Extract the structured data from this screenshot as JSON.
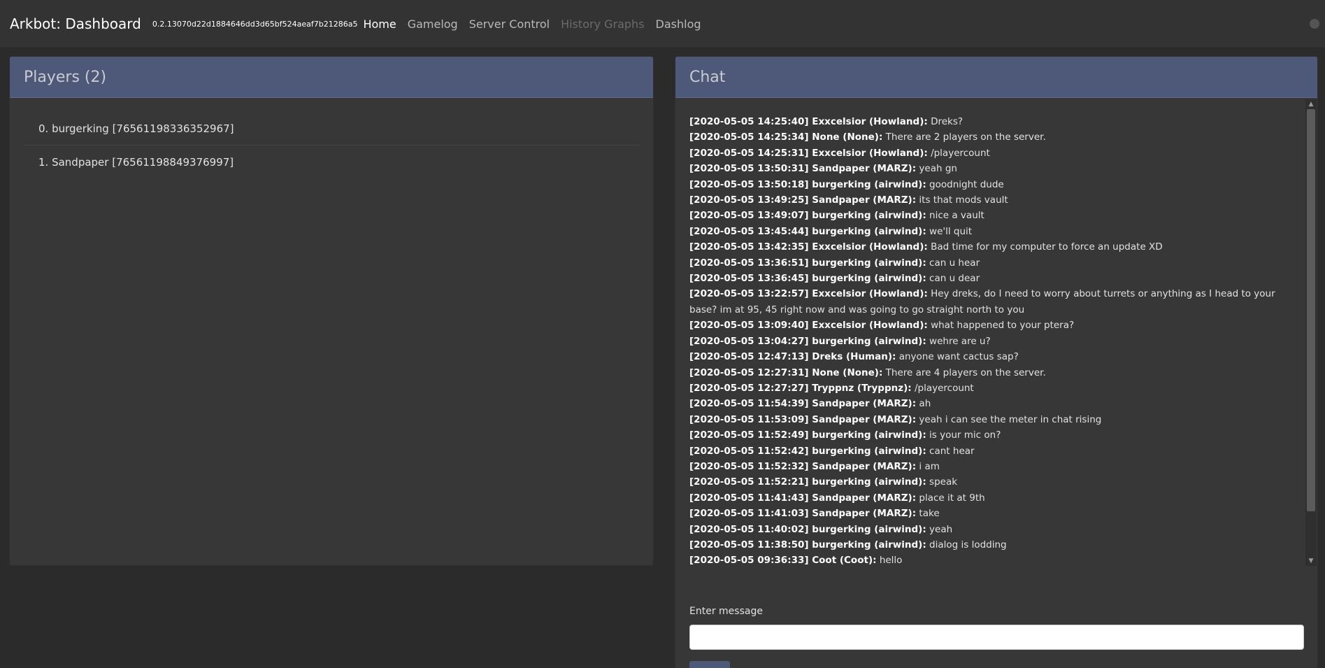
{
  "navbar": {
    "brand": "Arkbot: Dashboard",
    "version": "0.2.13070d22d1884646dd3d65bf524aeaf7b21286a5",
    "links": [
      {
        "label": "Home",
        "state": "active"
      },
      {
        "label": "Gamelog",
        "state": "normal"
      },
      {
        "label": "Server Control",
        "state": "normal"
      },
      {
        "label": "History Graphs",
        "state": "disabled"
      },
      {
        "label": "Dashlog",
        "state": "normal"
      }
    ]
  },
  "players": {
    "title": "Players (2)",
    "items": [
      "0. burgerking [76561198336352967]",
      "1. Sandpaper [76561198849376997]"
    ]
  },
  "chat": {
    "title": "Chat",
    "messages": [
      {
        "prefix": "[2020-05-05 14:25:40] Exxcelsior (Howland):",
        "text": "Dreks?"
      },
      {
        "prefix": "[2020-05-05 14:25:34] None (None):",
        "text": "There are 2 players on the server."
      },
      {
        "prefix": "[2020-05-05 14:25:31] Exxcelsior (Howland):",
        "text": "/playercount"
      },
      {
        "prefix": "[2020-05-05 13:50:31] Sandpaper (MARZ):",
        "text": "yeah gn"
      },
      {
        "prefix": "[2020-05-05 13:50:18] burgerking (airwind):",
        "text": "goodnight dude"
      },
      {
        "prefix": "[2020-05-05 13:49:25] Sandpaper (MARZ):",
        "text": "its that mods vault"
      },
      {
        "prefix": "[2020-05-05 13:49:07] burgerking (airwind):",
        "text": "nice a vault"
      },
      {
        "prefix": "[2020-05-05 13:45:44] burgerking (airwind):",
        "text": "we'll quit"
      },
      {
        "prefix": "[2020-05-05 13:42:35] Exxcelsior (Howland):",
        "text": "Bad time for my computer to force an update XD"
      },
      {
        "prefix": "[2020-05-05 13:36:51] burgerking (airwind):",
        "text": "can u hear"
      },
      {
        "prefix": "[2020-05-05 13:36:45] burgerking (airwind):",
        "text": "can u dear"
      },
      {
        "prefix": "[2020-05-05 13:22:57] Exxcelsior (Howland):",
        "text": "Hey dreks, do I need to worry about turrets or anything as I head to your base? im at 95, 45 right now and was going to go straight north to you"
      },
      {
        "prefix": "[2020-05-05 13:09:40] Exxcelsior (Howland):",
        "text": "what happened to your ptera?"
      },
      {
        "prefix": "[2020-05-05 13:04:27] burgerking (airwind):",
        "text": "wehre are u?"
      },
      {
        "prefix": "[2020-05-05 12:47:13] Dreks (Human):",
        "text": "anyone want cactus sap?"
      },
      {
        "prefix": "[2020-05-05 12:27:31] None (None):",
        "text": "There are 4 players on the server."
      },
      {
        "prefix": "[2020-05-05 12:27:27] Tryppnz (Tryppnz):",
        "text": "/playercount"
      },
      {
        "prefix": "[2020-05-05 11:54:39] Sandpaper (MARZ):",
        "text": "ah"
      },
      {
        "prefix": "[2020-05-05 11:53:09] Sandpaper (MARZ):",
        "text": "yeah i can see the meter in chat rising"
      },
      {
        "prefix": "[2020-05-05 11:52:49] burgerking (airwind):",
        "text": "is your mic on?"
      },
      {
        "prefix": "[2020-05-05 11:52:42] burgerking (airwind):",
        "text": "cant hear"
      },
      {
        "prefix": "[2020-05-05 11:52:32] Sandpaper (MARZ):",
        "text": "i am"
      },
      {
        "prefix": "[2020-05-05 11:52:21] burgerking (airwind):",
        "text": "speak"
      },
      {
        "prefix": "[2020-05-05 11:41:43] Sandpaper (MARZ):",
        "text": "place it at 9th"
      },
      {
        "prefix": "[2020-05-05 11:41:03] Sandpaper (MARZ):",
        "text": "take"
      },
      {
        "prefix": "[2020-05-05 11:40:02] burgerking (airwind):",
        "text": "yeah"
      },
      {
        "prefix": "[2020-05-05 11:38:50] burgerking (airwind):",
        "text": "dialog is lodding"
      },
      {
        "prefix": "[2020-05-05 09:36:33] Coot (Coot):",
        "text": "hello"
      }
    ],
    "input_label": "Enter message",
    "input_value": "",
    "input_placeholder": ""
  },
  "icons": {
    "status": "status-dot-icon",
    "scroll_up": "chevron-up-icon",
    "scroll_down": "chevron-down-icon"
  },
  "colors": {
    "panel_header": "#4e5879",
    "background": "#2b2b2b",
    "navbar": "#333333",
    "panel_body": "#373737"
  }
}
